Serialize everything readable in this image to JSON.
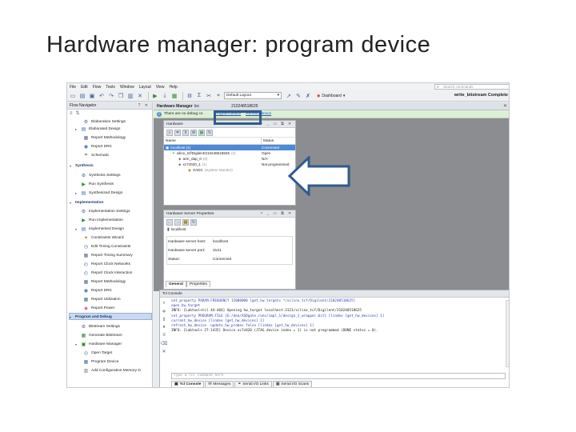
{
  "slide": {
    "title": "Hardware manager: program device"
  },
  "menu": [
    "File",
    "Edit",
    "Flow",
    "Tools",
    "Window",
    "Layout",
    "View",
    "Help"
  ],
  "search": {
    "placeholder": "Search commands"
  },
  "toolbar": {
    "layout": "Default Layout",
    "dashboard": "Dashboard",
    "status": "write_bitstream Complete"
  },
  "flow_navigator": {
    "title": "Flow Navigator",
    "items": [
      {
        "label": "Elaboration Settings",
        "level": 3,
        "icon": "settings-icon"
      },
      {
        "label": "Elaborated Design",
        "level": 2,
        "icon": "design-icon",
        "expand": "▸"
      },
      {
        "label": "Report Methodology",
        "level": 3,
        "icon": "report-icon"
      },
      {
        "label": "Report DRC",
        "level": 3,
        "icon": "drc-icon"
      },
      {
        "label": "Schematic",
        "level": 3,
        "icon": "schematic-icon"
      },
      {
        "label": "Synthesis",
        "level": 1,
        "section": true
      },
      {
        "label": "Synthesis Settings",
        "level": 2,
        "icon": "settings-icon"
      },
      {
        "label": "Run Synthesis",
        "level": 2,
        "icon": "run-icon"
      },
      {
        "label": "Synthesized Design",
        "level": 2,
        "icon": "design-icon",
        "expand": "▸"
      },
      {
        "label": "Implementation",
        "level": 1,
        "section": true
      },
      {
        "label": "Implementation Settings",
        "level": 2,
        "icon": "settings-icon"
      },
      {
        "label": "Run Implementation",
        "level": 2,
        "icon": "run-icon"
      },
      {
        "label": "Implemented Design",
        "level": 2,
        "icon": "design-icon",
        "expand": "▾"
      },
      {
        "label": "Constraints Wizard",
        "level": 3,
        "icon": "wizard-icon"
      },
      {
        "label": "Edit Timing Constraints",
        "level": 3,
        "icon": "timing-icon"
      },
      {
        "label": "Report Timing Summary",
        "level": 3,
        "icon": "report-icon"
      },
      {
        "label": "Report Clock Networks",
        "level": 3,
        "icon": "clock-icon"
      },
      {
        "label": "Report Clock Interaction",
        "level": 3,
        "icon": "clock-icon"
      },
      {
        "label": "Report Methodology",
        "level": 3,
        "icon": "report-icon"
      },
      {
        "label": "Report DRC",
        "level": 3,
        "icon": "drc-icon"
      },
      {
        "label": "Report Utilization",
        "level": 3,
        "icon": "report-icon"
      },
      {
        "label": "Report Power",
        "level": 3,
        "icon": "power-icon"
      },
      {
        "label": "Program and Debug",
        "level": 1,
        "section": true,
        "selected": true
      },
      {
        "label": "Bitstream Settings",
        "level": 2,
        "icon": "settings-icon"
      },
      {
        "label": "Generate Bitstream",
        "level": 2,
        "icon": "bitstream-icon"
      },
      {
        "label": "Hardware Manager",
        "level": 2,
        "icon": "hardware-icon",
        "expand": "▾"
      },
      {
        "label": "Open Target",
        "level": 3,
        "icon": "target-icon"
      },
      {
        "label": "Program Device",
        "level": 3,
        "icon": "program-icon"
      },
      {
        "label": "Add Configuration Memory D",
        "level": 3,
        "icon": "memory-icon"
      }
    ]
  },
  "hardware_manager": {
    "title": "Hardware Manager",
    "title_target": "loc",
    "title_suffix": "210248518625",
    "notice": "There are no debug co",
    "link_program": "Program device",
    "link_refresh": "Refresh device"
  },
  "hardware_panel": {
    "title": "Hardware",
    "columns": [
      "Name",
      "Status"
    ],
    "rows": [
      {
        "name": "localhost (1)",
        "status": "Connected",
        "indent": 2,
        "selected": true
      },
      {
        "name": "xilinx_tcf/Digilent/210248518625",
        "status": "Open",
        "indent": 10,
        "suffix": "(2)"
      },
      {
        "name": "arm_dap_0",
        "status": "N/A",
        "indent": 18,
        "suffix": "(0)"
      },
      {
        "name": "xc7z020_1",
        "status": "Not programmed",
        "indent": 18,
        "suffix": "(1)"
      },
      {
        "name": "XADC",
        "status": "",
        "indent": 30,
        "suffix": "(System Monitor)"
      }
    ]
  },
  "server_props": {
    "title": "Hardware Server Properties",
    "host_label": "localhost",
    "fields": [
      {
        "k": "Hardware server host:",
        "v": "localhost"
      },
      {
        "k": "Hardware server port:",
        "v": "3121"
      },
      {
        "k": "Status:",
        "v": "Connected"
      }
    ],
    "tabs": [
      "General",
      "Properties"
    ]
  },
  "tcl_console": {
    "title": "Tcl Console",
    "lines": [
      "set_property PARAM.FREQUENCY 15000000 [get_hw_targets */xilinx_tcf/Digilent/210248518625]",
      "open_hw_target",
      "INFO: [Labtoolstcl 44-466] Opening hw_target localhost:3121/xilinx_tcf/Digilent/210248518625",
      "set_property PROGRAM.FILE {E:/dea/ASDgate.runs/impl_1/design_1_wrapper.bit} [lindex [get_hw_devices] 1]",
      "current_hw_device [lindex [get_hw_devices] 1]",
      "refresh_hw_device -update_hw_probes false [lindex [get_hw_devices] 1]",
      "INFO: [Labtools 27-1435] Device xc7z020 (JTAG device index = 1) is not programmed (DONE status = 0)."
    ],
    "input_placeholder": "Type a Tcl command here",
    "tabs": [
      "Tcl Console",
      "Messages",
      "Serial I/O Links",
      "Serial I/O Scans"
    ]
  }
}
